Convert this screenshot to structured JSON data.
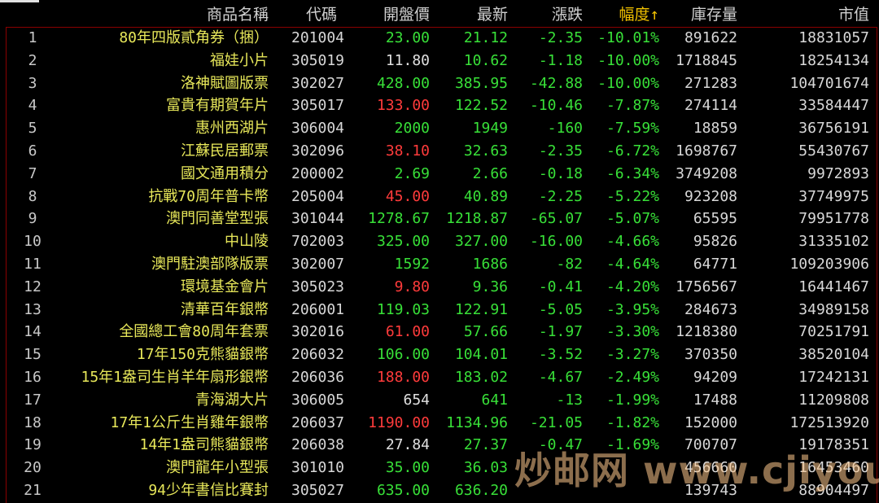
{
  "colors": {
    "up": "#ff3b3b",
    "down": "#38e038",
    "flat": "#e0e0e0",
    "name": "#e8e85a",
    "sort_header": "#f0c000"
  },
  "header": {
    "name": "商品名稱",
    "code": "代碼",
    "open": "開盤價",
    "last": "最新",
    "change": "漲跌",
    "pct": "幅度",
    "pct_arrow": "↑",
    "stock": "庫存量",
    "market_value": "市值"
  },
  "rows": [
    {
      "idx": "1",
      "name": "80年四版貳角券（捆）",
      "code": "201004",
      "open": "23.00",
      "open_dir": "down",
      "last": "21.12",
      "last_dir": "down",
      "change": "-2.35",
      "pct": "-10.01%",
      "stock": "891622",
      "mv": "18831057"
    },
    {
      "idx": "2",
      "name": "福娃小片",
      "code": "305019",
      "open": "11.80",
      "open_dir": "flat",
      "last": "10.62",
      "last_dir": "down",
      "change": "-1.18",
      "pct": "-10.00%",
      "stock": "1718845",
      "mv": "18254134"
    },
    {
      "idx": "3",
      "name": "洛神賦圖版票",
      "code": "302027",
      "open": "428.00",
      "open_dir": "down",
      "last": "385.95",
      "last_dir": "down",
      "change": "-42.88",
      "pct": "-10.00%",
      "stock": "271283",
      "mv": "104701674"
    },
    {
      "idx": "4",
      "name": "富貴有期賀年片",
      "code": "305017",
      "open": "133.00",
      "open_dir": "up",
      "last": "122.52",
      "last_dir": "down",
      "change": "-10.46",
      "pct": "-7.87%",
      "stock": "274114",
      "mv": "33584447"
    },
    {
      "idx": "5",
      "name": "惠州西湖片",
      "code": "306004",
      "open": "2000",
      "open_dir": "down",
      "last": "1949",
      "last_dir": "down",
      "change": "-160",
      "pct": "-7.59%",
      "stock": "18859",
      "mv": "36756191"
    },
    {
      "idx": "6",
      "name": "江蘇民居郵票",
      "code": "302096",
      "open": "38.10",
      "open_dir": "up",
      "last": "32.63",
      "last_dir": "down",
      "change": "-2.35",
      "pct": "-6.72%",
      "stock": "1698767",
      "mv": "55430767"
    },
    {
      "idx": "7",
      "name": "國文通用積分",
      "code": "200002",
      "open": "2.69",
      "open_dir": "down",
      "last": "2.66",
      "last_dir": "down",
      "change": "-0.18",
      "pct": "-6.34%",
      "stock": "3749208",
      "mv": "9972893"
    },
    {
      "idx": "8",
      "name": "抗戰70周年普卡幣",
      "code": "205004",
      "open": "45.00",
      "open_dir": "up",
      "last": "40.89",
      "last_dir": "down",
      "change": "-2.25",
      "pct": "-5.22%",
      "stock": "923208",
      "mv": "37749975"
    },
    {
      "idx": "9",
      "name": "澳門同善堂型張",
      "code": "301044",
      "open": "1278.67",
      "open_dir": "down",
      "last": "1218.87",
      "last_dir": "down",
      "change": "-65.07",
      "pct": "-5.07%",
      "stock": "65595",
      "mv": "79951778"
    },
    {
      "idx": "10",
      "name": "中山陵",
      "code": "702003",
      "open": "325.00",
      "open_dir": "down",
      "last": "327.00",
      "last_dir": "down",
      "change": "-16.00",
      "pct": "-4.66%",
      "stock": "95826",
      "mv": "31335102"
    },
    {
      "idx": "11",
      "name": "澳門駐澳部隊版票",
      "code": "302007",
      "open": "1592",
      "open_dir": "down",
      "last": "1686",
      "last_dir": "down",
      "change": "-82",
      "pct": "-4.64%",
      "stock": "64771",
      "mv": "109203906"
    },
    {
      "idx": "12",
      "name": "環境基金會片",
      "code": "305023",
      "open": "9.80",
      "open_dir": "up",
      "last": "9.36",
      "last_dir": "down",
      "change": "-0.41",
      "pct": "-4.20%",
      "stock": "1756567",
      "mv": "16441467"
    },
    {
      "idx": "13",
      "name": "清華百年銀幣",
      "code": "206001",
      "open": "119.03",
      "open_dir": "down",
      "last": "122.91",
      "last_dir": "down",
      "change": "-5.05",
      "pct": "-3.95%",
      "stock": "284673",
      "mv": "34989158"
    },
    {
      "idx": "14",
      "name": "全國總工會80周年套票",
      "code": "302016",
      "open": "61.00",
      "open_dir": "up",
      "last": "57.66",
      "last_dir": "down",
      "change": "-1.97",
      "pct": "-3.30%",
      "stock": "1218380",
      "mv": "70251791"
    },
    {
      "idx": "15",
      "name": "17年150克熊貓銀幣",
      "code": "206032",
      "open": "106.00",
      "open_dir": "down",
      "last": "104.01",
      "last_dir": "down",
      "change": "-3.52",
      "pct": "-3.27%",
      "stock": "370350",
      "mv": "38520104"
    },
    {
      "idx": "16",
      "name": "15年1盎司生肖羊年扇形銀幣",
      "code": "206036",
      "open": "188.00",
      "open_dir": "up",
      "last": "183.02",
      "last_dir": "down",
      "change": "-4.67",
      "pct": "-2.49%",
      "stock": "94209",
      "mv": "17242131"
    },
    {
      "idx": "17",
      "name": "青海湖大片",
      "code": "306005",
      "open": "654",
      "open_dir": "flat",
      "last": "641",
      "last_dir": "down",
      "change": "-13",
      "pct": "-1.99%",
      "stock": "17488",
      "mv": "11209808"
    },
    {
      "idx": "18",
      "name": "17年1公斤生肖雞年銀幣",
      "code": "206037",
      "open": "1190.00",
      "open_dir": "up",
      "last": "1134.96",
      "last_dir": "down",
      "change": "-21.05",
      "pct": "-1.82%",
      "stock": "152000",
      "mv": "172513920"
    },
    {
      "idx": "19",
      "name": "14年1盎司熊貓銀幣",
      "code": "206038",
      "open": "27.84",
      "open_dir": "flat",
      "last": "27.37",
      "last_dir": "down",
      "change": "-0.47",
      "pct": "-1.69%",
      "stock": "700707",
      "mv": "19178351"
    },
    {
      "idx": "20",
      "name": "澳門龍年小型張",
      "code": "301010",
      "open": "35.00",
      "open_dir": "down",
      "last": "36.03",
      "last_dir": "down",
      "change": "",
      "pct": "",
      "stock": "456660",
      "mv": "16453460"
    },
    {
      "idx": "21",
      "name": "94少年書信比賽封",
      "code": "305027",
      "open": "635.00",
      "open_dir": "down",
      "last": "636.20",
      "last_dir": "down",
      "change": "",
      "pct": "",
      "stock": "139743",
      "mv": "88904497"
    }
  ],
  "watermark": "炒邮网 www.cjiyou.net"
}
